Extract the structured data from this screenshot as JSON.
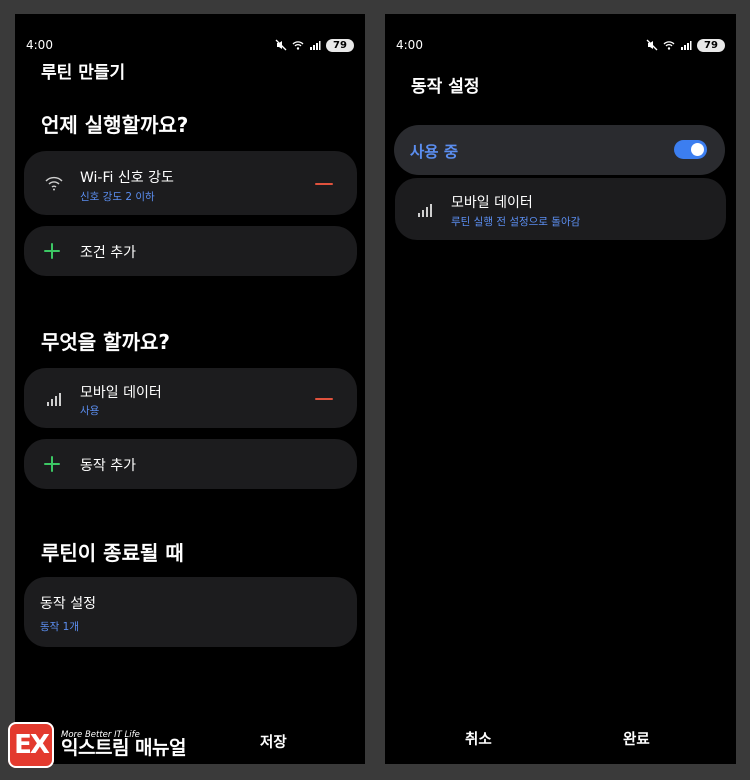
{
  "left_screen": {
    "status_bar": {
      "time": "4:00",
      "battery": "79"
    },
    "page_title": "루틴 만들기",
    "when_section": {
      "title": "언제 실행할까요?",
      "condition": {
        "title": "Wi-Fi 신호 강도",
        "subtitle": "신호 강도 2 이하"
      },
      "add_label": "조건 추가"
    },
    "what_section": {
      "title": "무엇을 할까요?",
      "action": {
        "title": "모바일 데이터",
        "subtitle": "사용"
      },
      "add_label": "동작 추가"
    },
    "end_section": {
      "title": "루틴이 종료될 때",
      "card": {
        "title": "동작 설정",
        "subtitle": "동작 1개"
      }
    },
    "save_label": "저장"
  },
  "right_screen": {
    "status_bar": {
      "time": "4:00",
      "battery": "79"
    },
    "page_title": "동작 설정",
    "toggle": {
      "label": "사용 중",
      "on": true
    },
    "item": {
      "title": "모바일 데이터",
      "subtitle": "루틴 실행 전 설정으로 돌아감"
    },
    "cancel_label": "취소",
    "done_label": "완료"
  },
  "watermark": {
    "logo_letters": "EX",
    "tagline": "More Better IT Life",
    "name": "익스트림 매뉴얼"
  },
  "colors": {
    "accent_blue": "#5b8ef0",
    "toggle_blue": "#3c7ef0",
    "minus_red": "#e0523d",
    "plus_green": "#3cc764",
    "card_bg": "#1c1c1e"
  }
}
